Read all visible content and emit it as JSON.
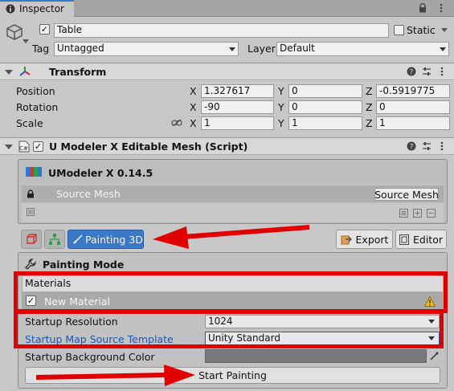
{
  "tab": {
    "label": "Inspector"
  },
  "object": {
    "name": "Table",
    "active": true,
    "static_label": "Static",
    "tag_label": "Tag",
    "tag_value": "Untagged",
    "layer_label": "Layer",
    "layer_value": "Default"
  },
  "transform": {
    "title": "Transform",
    "rows": [
      {
        "label": "Position",
        "x": "1.327617",
        "y": "0",
        "z": "-0.5919775"
      },
      {
        "label": "Rotation",
        "x": "-90",
        "y": "0",
        "z": "0"
      },
      {
        "label": "Scale",
        "x": "1",
        "y": "1",
        "z": "1"
      }
    ],
    "axis_x": "X",
    "axis_y": "Y",
    "axis_z": "Z"
  },
  "script": {
    "title": "U Modeler X Editable Mesh (Script)",
    "enabled": true
  },
  "umodeler": {
    "version_label": "UModeler X 0.14.5",
    "source_mesh_label": "Source Mesh",
    "source_mesh_button": "Source Mesh",
    "tabs": {
      "painting": "Painting 3D",
      "export": "Export",
      "editor": "Editor"
    }
  },
  "painting": {
    "mode_title": "Painting Mode",
    "materials_header": "Materials",
    "material_item": "New Material",
    "startup_resolution_label": "Startup Resolution",
    "startup_resolution_value": "1024",
    "template_label": "Startup Map Source Template",
    "template_value": "Unity Standard",
    "bg_color_label": "Startup Background Color",
    "bg_color": "#7a7a7a",
    "start_button": "Start Painting"
  },
  "colors": {
    "highlight_red": "#e00000",
    "tab_active": "#3a78c9",
    "link_blue": "#1a55b5"
  }
}
